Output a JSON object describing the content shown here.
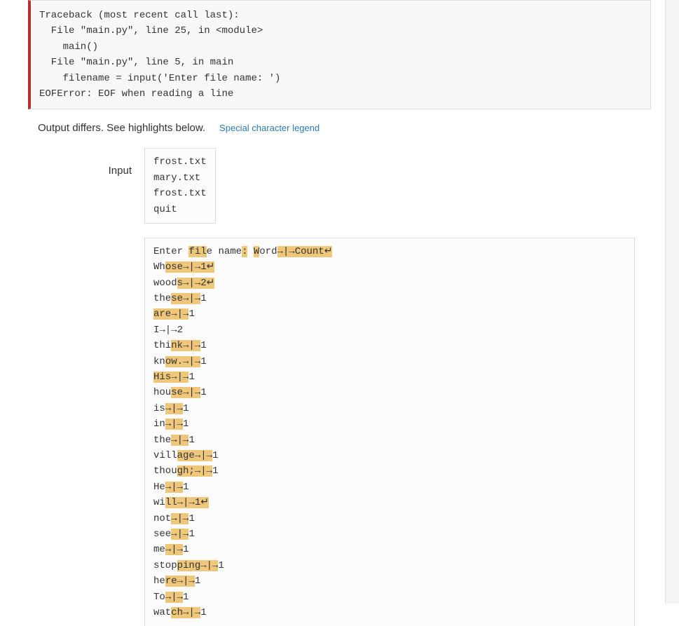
{
  "traceback": "Traceback (most recent call last):\n  File \"main.py\", line 25, in <module>\n    main()\n  File \"main.py\", line 5, in main\n    filename = input('Enter file name: ')\nEOFError: EOF when reading a line",
  "diff_message": "Output differs. See highlights below.",
  "legend_link": "Special character legend",
  "input_label": "Input",
  "input_lines": [
    "frost.txt",
    "mary.txt",
    "frost.txt",
    "quit"
  ],
  "tab_char": "→|",
  "arrow_char": "→",
  "nl_char": "↵",
  "output_rows": [
    {
      "segments": [
        {
          "t": "Enter "
        },
        {
          "t": "fil",
          "hl": true
        },
        {
          "t": "e name"
        },
        {
          "t": ":",
          "hl": true
        },
        {
          "t": " "
        },
        {
          "t": "W",
          "hl": true
        },
        {
          "t": "ord"
        },
        {
          "t": "{tab}{arrow}Count{nl}",
          "hl": true
        }
      ]
    },
    {
      "segments": [
        {
          "t": "Wh"
        },
        {
          "t": "ose{tab}{arrow}1",
          "hl": true
        },
        {
          "t": "{nl}",
          "hl": true
        }
      ]
    },
    {
      "segments": [
        {
          "t": "wood"
        },
        {
          "t": "s{tab}{arrow}2{nl}",
          "hl": true
        }
      ]
    },
    {
      "segments": [
        {
          "t": "the"
        },
        {
          "t": "se{tab}{arrow}",
          "hl": true
        },
        {
          "t": "1"
        }
      ]
    },
    {
      "segments": [
        {
          "t": "are",
          "hl": true
        },
        {
          "t": "{tab}{arrow}",
          "hl": true
        },
        {
          "t": "1"
        }
      ]
    },
    {
      "segments": [
        {
          "t": "I"
        },
        {
          "t": "{tab}{arrow}"
        },
        {
          "t": "2"
        }
      ]
    },
    {
      "segments": [
        {
          "t": "thi"
        },
        {
          "t": "nk{tab}{arrow}",
          "hl": true
        },
        {
          "t": "1"
        }
      ]
    },
    {
      "segments": [
        {
          "t": "kn"
        },
        {
          "t": "ow.{tab}{arrow}",
          "hl": true
        },
        {
          "t": "1"
        }
      ]
    },
    {
      "segments": [
        {
          "t": "His",
          "hl": true
        },
        {
          "t": "{tab}{arrow}",
          "hl": true
        },
        {
          "t": "1"
        }
      ]
    },
    {
      "segments": [
        {
          "t": "hou"
        },
        {
          "t": "se{tab}{arrow}",
          "hl": true
        },
        {
          "t": "1"
        }
      ]
    },
    {
      "segments": [
        {
          "t": "is"
        },
        {
          "t": "{tab}{arrow}",
          "hl": true
        },
        {
          "t": "1"
        }
      ]
    },
    {
      "segments": [
        {
          "t": "in"
        },
        {
          "t": "{tab}{arrow}",
          "hl": true
        },
        {
          "t": "1"
        }
      ]
    },
    {
      "segments": [
        {
          "t": "the"
        },
        {
          "t": "{tab}{arrow}",
          "hl": true
        },
        {
          "t": "1"
        }
      ]
    },
    {
      "segments": [
        {
          "t": "vill"
        },
        {
          "t": "age{tab}{arrow}",
          "hl": true
        },
        {
          "t": "1"
        }
      ]
    },
    {
      "segments": [
        {
          "t": "thou"
        },
        {
          "t": "gh;{tab}{arrow}",
          "hl": true
        },
        {
          "t": "1"
        }
      ]
    },
    {
      "segments": [
        {
          "t": "He"
        },
        {
          "t": "{tab}{arrow}",
          "hl": true
        },
        {
          "t": "1"
        }
      ]
    },
    {
      "segments": [
        {
          "t": "wi"
        },
        {
          "t": "ll{tab}{arrow}1",
          "hl": true
        },
        {
          "t": "{nl}",
          "hl": true
        }
      ]
    },
    {
      "segments": [
        {
          "t": "not"
        },
        {
          "t": "{tab}{arrow}",
          "hl": true
        },
        {
          "t": "1"
        }
      ]
    },
    {
      "segments": [
        {
          "t": "see"
        },
        {
          "t": "{tab}{arrow}",
          "hl": true
        },
        {
          "t": "1"
        }
      ]
    },
    {
      "segments": [
        {
          "t": "me"
        },
        {
          "t": "{tab}{arrow}",
          "hl": true
        },
        {
          "t": "1"
        }
      ]
    },
    {
      "segments": [
        {
          "t": "stop"
        },
        {
          "t": "ping{tab}{arrow}",
          "hl": true
        },
        {
          "t": "1"
        }
      ]
    },
    {
      "segments": [
        {
          "t": "he"
        },
        {
          "t": "re{tab}{arrow}",
          "hl": true
        },
        {
          "t": "1"
        }
      ]
    },
    {
      "segments": [
        {
          "t": "To"
        },
        {
          "t": "{tab}{arrow}",
          "hl": true
        },
        {
          "t": "1"
        }
      ]
    },
    {
      "segments": [
        {
          "t": "wat"
        },
        {
          "t": "ch{tab}{arrow}",
          "hl": true
        },
        {
          "t": "1"
        }
      ]
    }
  ]
}
